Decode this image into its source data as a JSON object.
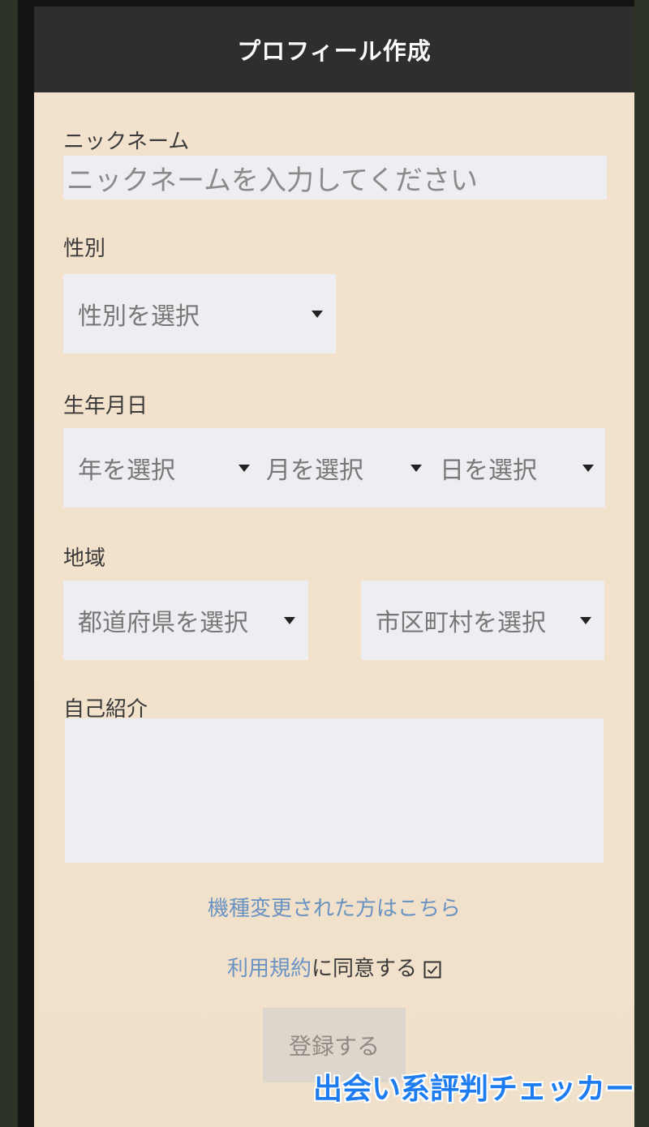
{
  "header": {
    "title": "プロフィール作成"
  },
  "form": {
    "nickname": {
      "label": "ニックネーム",
      "placeholder": "ニックネームを入力してください"
    },
    "gender": {
      "label": "性別",
      "placeholder": "性別を選択"
    },
    "birthdate": {
      "label": "生年月日",
      "year": "年を選択",
      "month": "月を選択",
      "day": "日を選択"
    },
    "region": {
      "label": "地域",
      "prefecture": "都道府県を選択",
      "city": "市区町村を選択"
    },
    "bio": {
      "label": "自己紹介",
      "value": ""
    }
  },
  "links": {
    "device_change": "機種変更された方はこちら",
    "terms_link": "利用規約",
    "terms_suffix": "に同意する"
  },
  "terms_checked": true,
  "submit_label": "登録する",
  "watermark": "出会い系評判チェッカー",
  "colors": {
    "header": "#2e2e2e",
    "background": "#f2e2cd",
    "link": "#6a93c2",
    "watermark": "#1c7cf0"
  },
  "icons": {
    "dropdown": "caret-down-icon",
    "checkbox": "checkbox-checked-icon"
  }
}
